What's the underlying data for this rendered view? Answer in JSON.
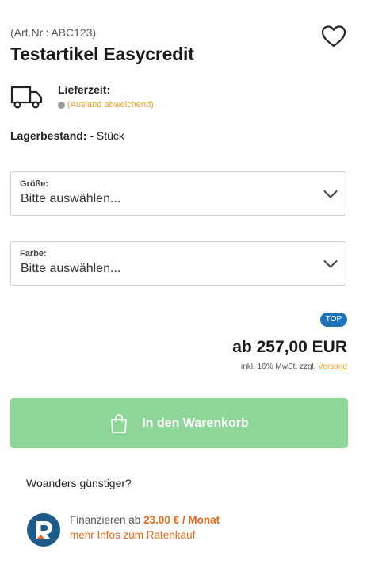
{
  "product": {
    "article_number": "(Art.Nr.: ABC123)",
    "name": "Testartikel Easycredit"
  },
  "delivery": {
    "label": "Lieferzeit:",
    "status": "(Ausland abweichend)"
  },
  "stock": {
    "label": "Lagerbestand:",
    "value": " - Stück"
  },
  "options": {
    "size": {
      "label": "Größe:",
      "value": "Bitte auswählen..."
    },
    "color": {
      "label": "Farbe:",
      "value": "Bitte auswählen..."
    }
  },
  "pricing": {
    "badge": "TOP",
    "price": "ab 257,00 EUR",
    "tax_note": "inkl. 16% MwSt. zzgl. ",
    "shipping_link": "Versand"
  },
  "cart": {
    "button_label": "In den Warenkorb"
  },
  "cheaper": {
    "text": "Woanders günstiger?"
  },
  "financing": {
    "prefix": "Finanzieren ab ",
    "amount": "23.00 € / Monat",
    "link": "mehr Infos zum Ratenkauf"
  },
  "colors": {
    "accent_orange": "#e36a1c",
    "status_yellow": "#f0a32a",
    "cart_green": "#8fd798",
    "badge_blue": "#1d72b8"
  },
  "icons": {
    "wishlist": "heart-icon",
    "delivery": "truck-icon",
    "dropdown": "chevron-down-icon",
    "cart": "shopping-bag-icon",
    "financing": "ratenkauf-logo"
  }
}
